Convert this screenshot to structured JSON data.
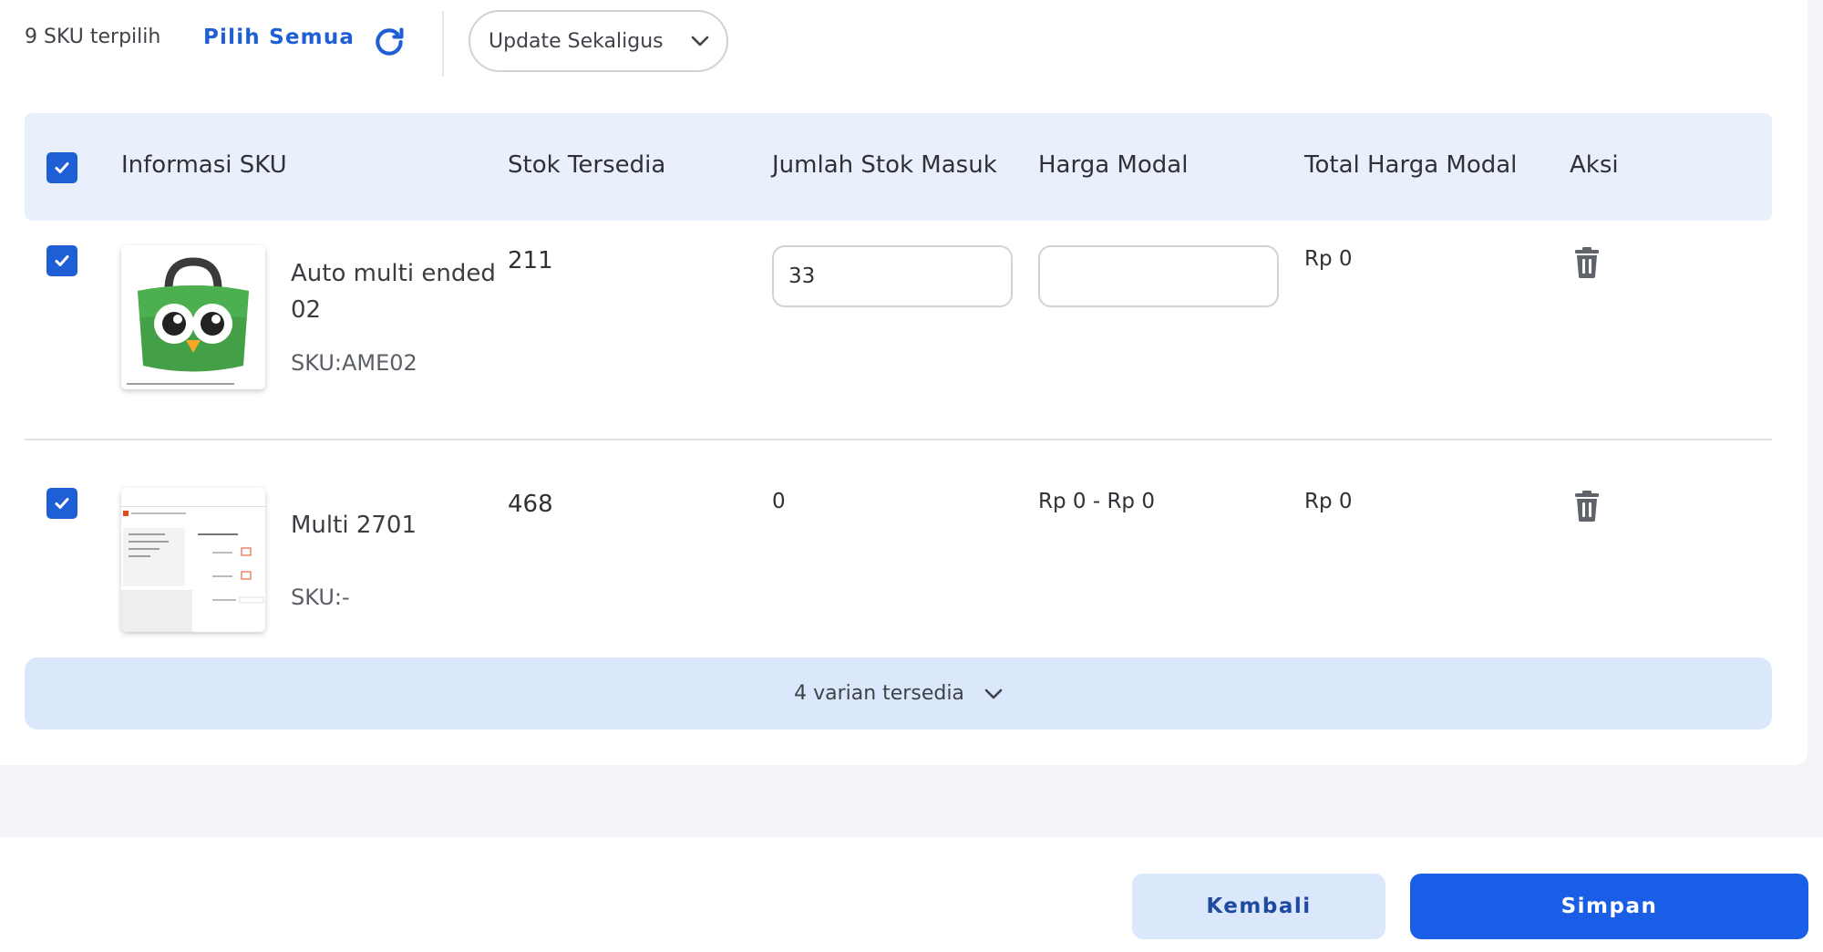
{
  "toolbar": {
    "selected_count": "9 SKU terpilih",
    "select_all_label": "Pilih Semua",
    "bulk_update_label": "Update Sekaligus"
  },
  "table": {
    "columns": [
      "Informasi SKU",
      "Stok Tersedia",
      "Jumlah Stok Masuk",
      "Harga Modal",
      "Total Harga Modal",
      "Aksi"
    ],
    "rows": [
      {
        "name_line1": "Auto multi ended",
        "name_line2": "02",
        "sku": "SKU:AME02",
        "stock": "211",
        "incoming_qty": "33",
        "cost_price": "",
        "total_cost": "Rp 0"
      },
      {
        "name_line1": "Multi 2701",
        "sku": "SKU:-",
        "stock": "468",
        "incoming_qty": "0",
        "cost_price": "Rp 0 - Rp 0",
        "total_cost": "Rp 0"
      }
    ],
    "variants_label": "4 varian tersedia"
  },
  "footer": {
    "back_label": "Kembali",
    "save_label": "Simpan"
  },
  "colors": {
    "accent": "#1a5ee8",
    "header_bg": "#e9f0fc",
    "variants_bg": "#dbe7fb"
  }
}
